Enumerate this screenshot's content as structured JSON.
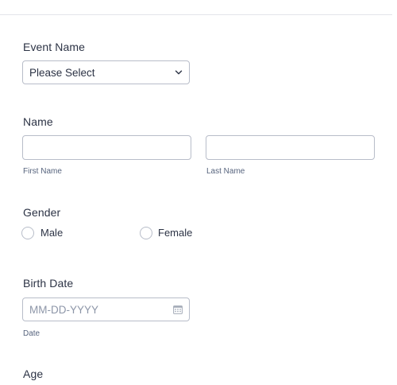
{
  "form": {
    "event_name": {
      "label": "Event Name",
      "selected": "Please Select",
      "icon": "chevron-down-icon"
    },
    "name": {
      "label": "Name",
      "first_value": "",
      "last_value": "",
      "first_sublabel": "First Name",
      "last_sublabel": "Last Name"
    },
    "gender": {
      "label": "Gender",
      "options": [
        "Male",
        "Female"
      ],
      "selected": null
    },
    "birth_date": {
      "label": "Birth Date",
      "placeholder": "MM-DD-YYYY",
      "sublabel": "Date",
      "icon": "calendar-icon"
    },
    "age": {
      "label": "Age"
    }
  },
  "colors": {
    "text": "#2c3345",
    "sublabel": "#57647e",
    "border": "#b8bdc9",
    "placeholder": "#8d96a8",
    "divider": "#e3e5ea"
  }
}
